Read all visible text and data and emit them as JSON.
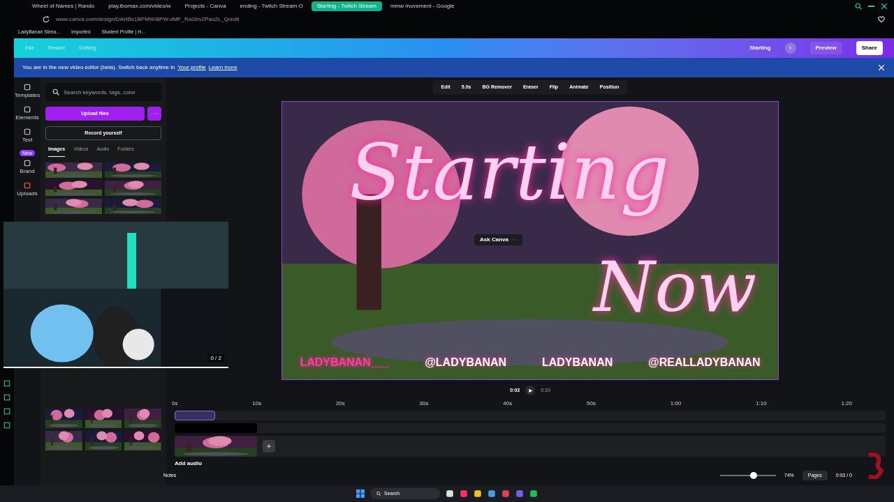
{
  "browser": {
    "tabs": [
      {
        "label": "Wheel of Names | Rando",
        "selected": false
      },
      {
        "label": "play.tbomax.com/video/w",
        "selected": false
      },
      {
        "label": "Projects - Canva",
        "selected": false
      },
      {
        "label": "ending - Twitch Stream O",
        "selected": false
      },
      {
        "label": "Starting - Twitch Stream",
        "selected": true
      },
      {
        "label": "mmw movement - Google",
        "selected": false
      }
    ],
    "url": "www.canva.com/design/DAHBs1BPMW/8PW-dMF_RaGhv2Pau2L_Q/edit",
    "bookmarks": [
      "LadyBanan Strea...",
      "Imported",
      "Student Profile | H..."
    ]
  },
  "header": {
    "menu": [
      "File",
      "Resize",
      "Editing"
    ],
    "title": "Starting",
    "avatar": "t",
    "preview": "Preview",
    "share": "Share"
  },
  "banner": {
    "text": "You are in the new video editor (beta). Switch back anytime in",
    "link1": "Your profile",
    "link2": "Learn more"
  },
  "toolbar": [
    "Edit",
    "5.0s",
    "BG Remover",
    "Eraser",
    "Flip",
    "Animate",
    "Position"
  ],
  "rail": [
    {
      "label": "Templates"
    },
    {
      "label": "Elements"
    },
    {
      "label": "Text"
    },
    {
      "label": "Brand",
      "badge": "New"
    },
    {
      "label": "Uploads"
    }
  ],
  "panel": {
    "search": {
      "placeholder": "Search keywords, tags, color"
    },
    "upload": "Upload files",
    "record": "Record yourself",
    "tabs": [
      {
        "label": "Images",
        "selected": true
      },
      {
        "label": "Videos",
        "selected": false
      },
      {
        "label": "Audio",
        "selected": false
      },
      {
        "label": "Folders",
        "selected": false
      }
    ]
  },
  "canvas": {
    "title1": "Starting",
    "title2": "Now",
    "handles": [
      "LADYBANAN___",
      "@LADYBANAN",
      "LADYBANAN",
      "@REALLADYBANAN"
    ],
    "ask": "Ask Canva"
  },
  "webcam": {
    "counter": "0 / 2"
  },
  "playback": {
    "current": "0:03",
    "total": "0:10"
  },
  "timeline": {
    "ticks": [
      "0s",
      "10s",
      "20s",
      "30s",
      "40s",
      "50s",
      "1:00",
      "1:10",
      "1:20"
    ],
    "add_audio": "Add audio"
  },
  "footer": {
    "notes": "Notes",
    "zoom": "74%",
    "zoom_slider": {
      "level": 0.6
    },
    "pages": "Pages",
    "time": "0:03 / 0"
  },
  "taskbar": {
    "search": "Search"
  }
}
